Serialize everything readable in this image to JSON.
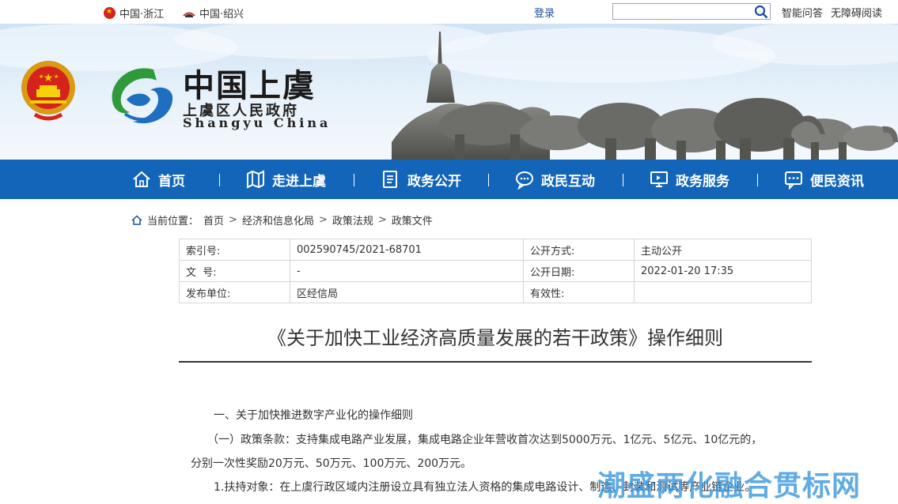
{
  "topbar": {
    "site1": "中国·浙江",
    "site2": "中国·绍兴",
    "login": "登录",
    "search_placeholder": "",
    "link_qa": "智能问答",
    "link_access": "无障碍阅读"
  },
  "banner": {
    "title": "中国上虞",
    "subtitle": "上虞区人民政府",
    "english": "Shangyu  China"
  },
  "nav": {
    "items": [
      {
        "label": "首页",
        "icon": "home-icon"
      },
      {
        "label": "走进上虞",
        "icon": "map-icon"
      },
      {
        "label": "政务公开",
        "icon": "document-icon"
      },
      {
        "label": "政民互动",
        "icon": "chat-icon"
      },
      {
        "label": "政务服务",
        "icon": "monitor-icon"
      },
      {
        "label": "便民资讯",
        "icon": "message-icon"
      }
    ]
  },
  "breadcrumb": {
    "prefix": "当前位置：",
    "items": [
      "首页",
      "经济和信息化局",
      "政策法规",
      "政策文件"
    ]
  },
  "meta": {
    "index_label": "索引号:",
    "index_value": "002590745/2021-68701",
    "open_mode_label": "公开方式:",
    "open_mode_value": "主动公开",
    "doc_no_label": "文  号:",
    "doc_no_value": "-",
    "open_date_label": "公开日期:",
    "open_date_value": "2022-01-20 17:35",
    "issuer_label": "发布单位:",
    "issuer_value": "区经信局",
    "validity_label": "有效性:",
    "validity_value": ""
  },
  "document": {
    "title": "《关于加快工业经济高质量发展的若干政策》操作细则",
    "lines": [
      "一、关于加快推进数字产业化的操作细则",
      "（一）政策条款：支持集成电路产业发展，集成电路企业年营收首次达到5000万元、1亿元、5亿元、10亿元的，",
      "分别一次性奖励20万元、50万元、100万元、200万元。",
      "1.扶持对象：在上虞行政区域内注册设立具有独立法人资格的集成电路设计、制造、封装和测试等产业链企业。"
    ]
  },
  "watermark": "潮盛两化融合贯标网",
  "colors": {
    "nav_bg": "#1265b8",
    "link": "#1a4e9c",
    "watermark": "#3a96dc"
  }
}
